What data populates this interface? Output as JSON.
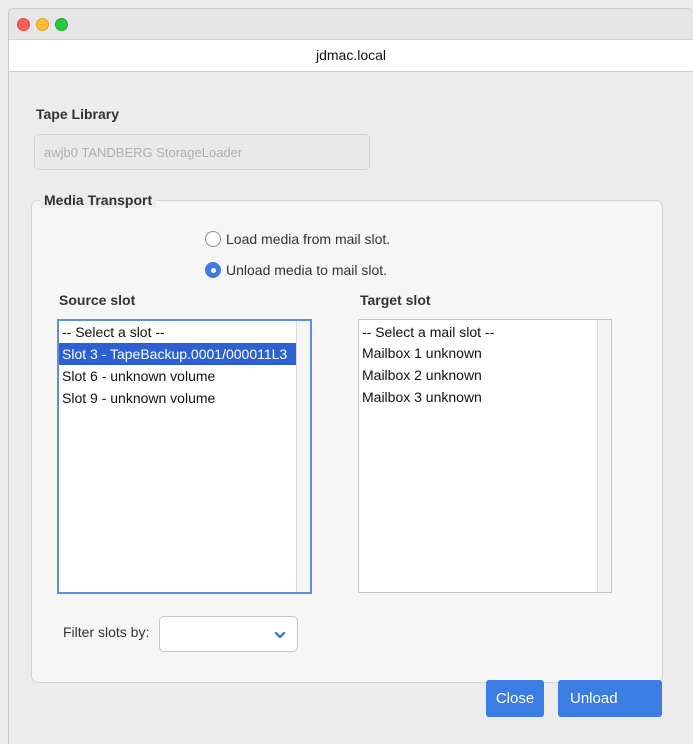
{
  "window": {
    "host": "jdmac.local"
  },
  "tape_library": {
    "label": "Tape Library",
    "value": "awjb0 TANDBERG StorageLoader"
  },
  "media_transport": {
    "legend": "Media Transport",
    "options": [
      {
        "label": "Load media from mail slot.",
        "selected": false
      },
      {
        "label": "Unload media to mail slot.",
        "selected": true
      }
    ]
  },
  "source_slot": {
    "label": "Source slot",
    "items": [
      "-- Select a slot --",
      "Slot 3 - TapeBackup.0001/000011L3",
      "Slot 6 - unknown volume",
      "Slot 9 - unknown volume"
    ],
    "selected_index": 1
  },
  "target_slot": {
    "label": "Target slot",
    "items": [
      "-- Select a mail slot --",
      "Mailbox 1 unknown",
      "Mailbox 2 unknown",
      "Mailbox 3 unknown"
    ]
  },
  "filter": {
    "label": "Filter slots by:",
    "value": ""
  },
  "buttons": {
    "close": "Close",
    "unload": "Unload"
  },
  "colors": {
    "accent": "#3b7de3",
    "selection": "#2d60d0"
  },
  "icons": {
    "filter_dropdown": "chevron-down-icon"
  }
}
